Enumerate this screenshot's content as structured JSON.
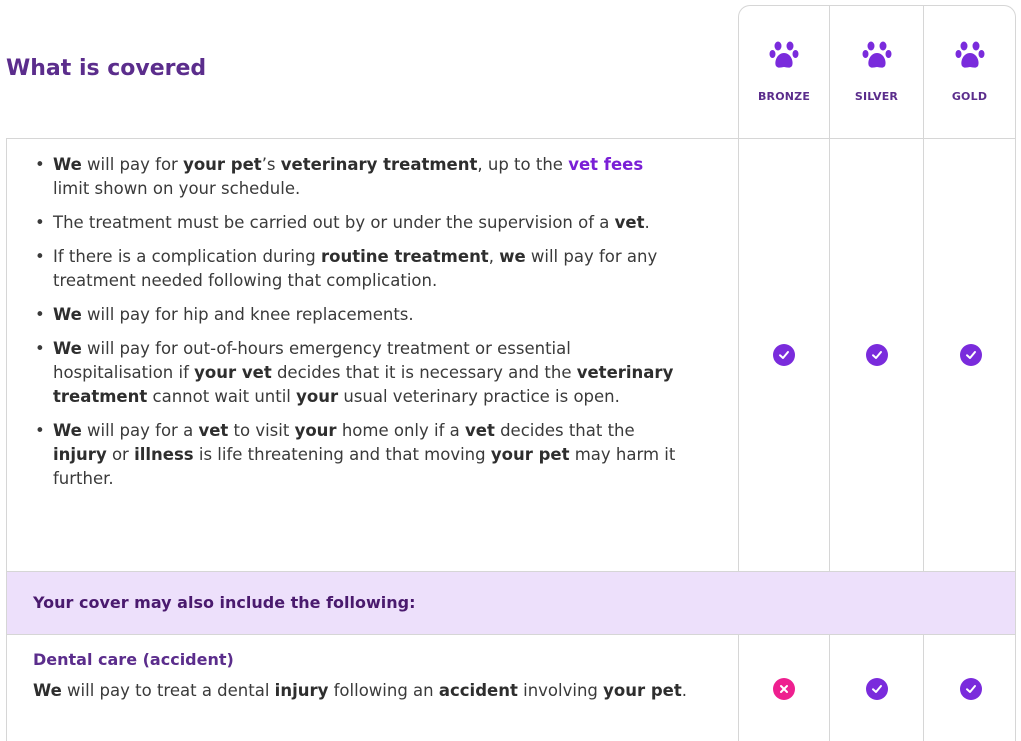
{
  "heading": "What is covered",
  "tiers": [
    {
      "label": "BRONZE"
    },
    {
      "label": "SILVER"
    },
    {
      "label": "GOLD"
    }
  ],
  "main_section": {
    "bullets": [
      [
        {
          "t": "We",
          "s": "b"
        },
        {
          "t": " will pay for "
        },
        {
          "t": "your pet",
          "s": "b"
        },
        {
          "t": "’s "
        },
        {
          "t": "veterinary treatment",
          "s": "b"
        },
        {
          "t": ", up to the "
        },
        {
          "t": "vet fees",
          "s": "p"
        },
        {
          "t": " limit shown on your schedule."
        }
      ],
      [
        {
          "t": "The treatment must be carried out by or under the supervision of a "
        },
        {
          "t": "vet",
          "s": "b"
        },
        {
          "t": "."
        }
      ],
      [
        {
          "t": "If there is a complication during "
        },
        {
          "t": "routine treatment",
          "s": "b"
        },
        {
          "t": ", "
        },
        {
          "t": "we",
          "s": "b"
        },
        {
          "t": " will pay for any treatment needed following that complication."
        }
      ],
      [
        {
          "t": "We",
          "s": "b"
        },
        {
          "t": " will pay for hip and knee replacements."
        }
      ],
      [
        {
          "t": "We",
          "s": "b"
        },
        {
          "t": " will pay for out-of-hours emergency treatment or essential hospitalisation if "
        },
        {
          "t": "your vet",
          "s": "b"
        },
        {
          "t": " decides that it is necessary and the "
        },
        {
          "t": "veterinary treatment",
          "s": "b"
        },
        {
          "t": " cannot wait until "
        },
        {
          "t": "your",
          "s": "b"
        },
        {
          "t": " usual veterinary practice is open."
        }
      ],
      [
        {
          "t": "We",
          "s": "b"
        },
        {
          "t": " will pay for a "
        },
        {
          "t": "vet",
          "s": "b"
        },
        {
          "t": " to visit "
        },
        {
          "t": "your",
          "s": "b"
        },
        {
          "t": " home only if a "
        },
        {
          "t": "vet",
          "s": "b"
        },
        {
          "t": " decides that the "
        },
        {
          "t": "injury",
          "s": "b"
        },
        {
          "t": " or "
        },
        {
          "t": "illness",
          "s": "b"
        },
        {
          "t": " is life threatening and that moving "
        },
        {
          "t": "your pet",
          "s": "b"
        },
        {
          "t": " may harm it further."
        }
      ]
    ],
    "coverage": [
      "included",
      "included",
      "included"
    ]
  },
  "subheader": "Your cover may also include the following:",
  "dental": {
    "title": "Dental care (accident)",
    "text": [
      {
        "t": "We",
        "s": "b"
      },
      {
        "t": " will pay to treat a dental "
      },
      {
        "t": "injury",
        "s": "b"
      },
      {
        "t": " following an "
      },
      {
        "t": "accident",
        "s": "b"
      },
      {
        "t": " involving "
      },
      {
        "t": "your pet",
        "s": "b"
      },
      {
        "t": "."
      }
    ],
    "coverage": [
      "not-included",
      "included",
      "included"
    ]
  },
  "colors": {
    "brand_purple": "#7a2bdc",
    "heading_purple": "#5b2d8c",
    "cross_pink": "#ee1f8f",
    "highlight_bg": "#ede0fb"
  },
  "icons": {
    "tier": "paw-icon",
    "included": "check-circle-icon",
    "not_included": "cross-circle-icon"
  }
}
